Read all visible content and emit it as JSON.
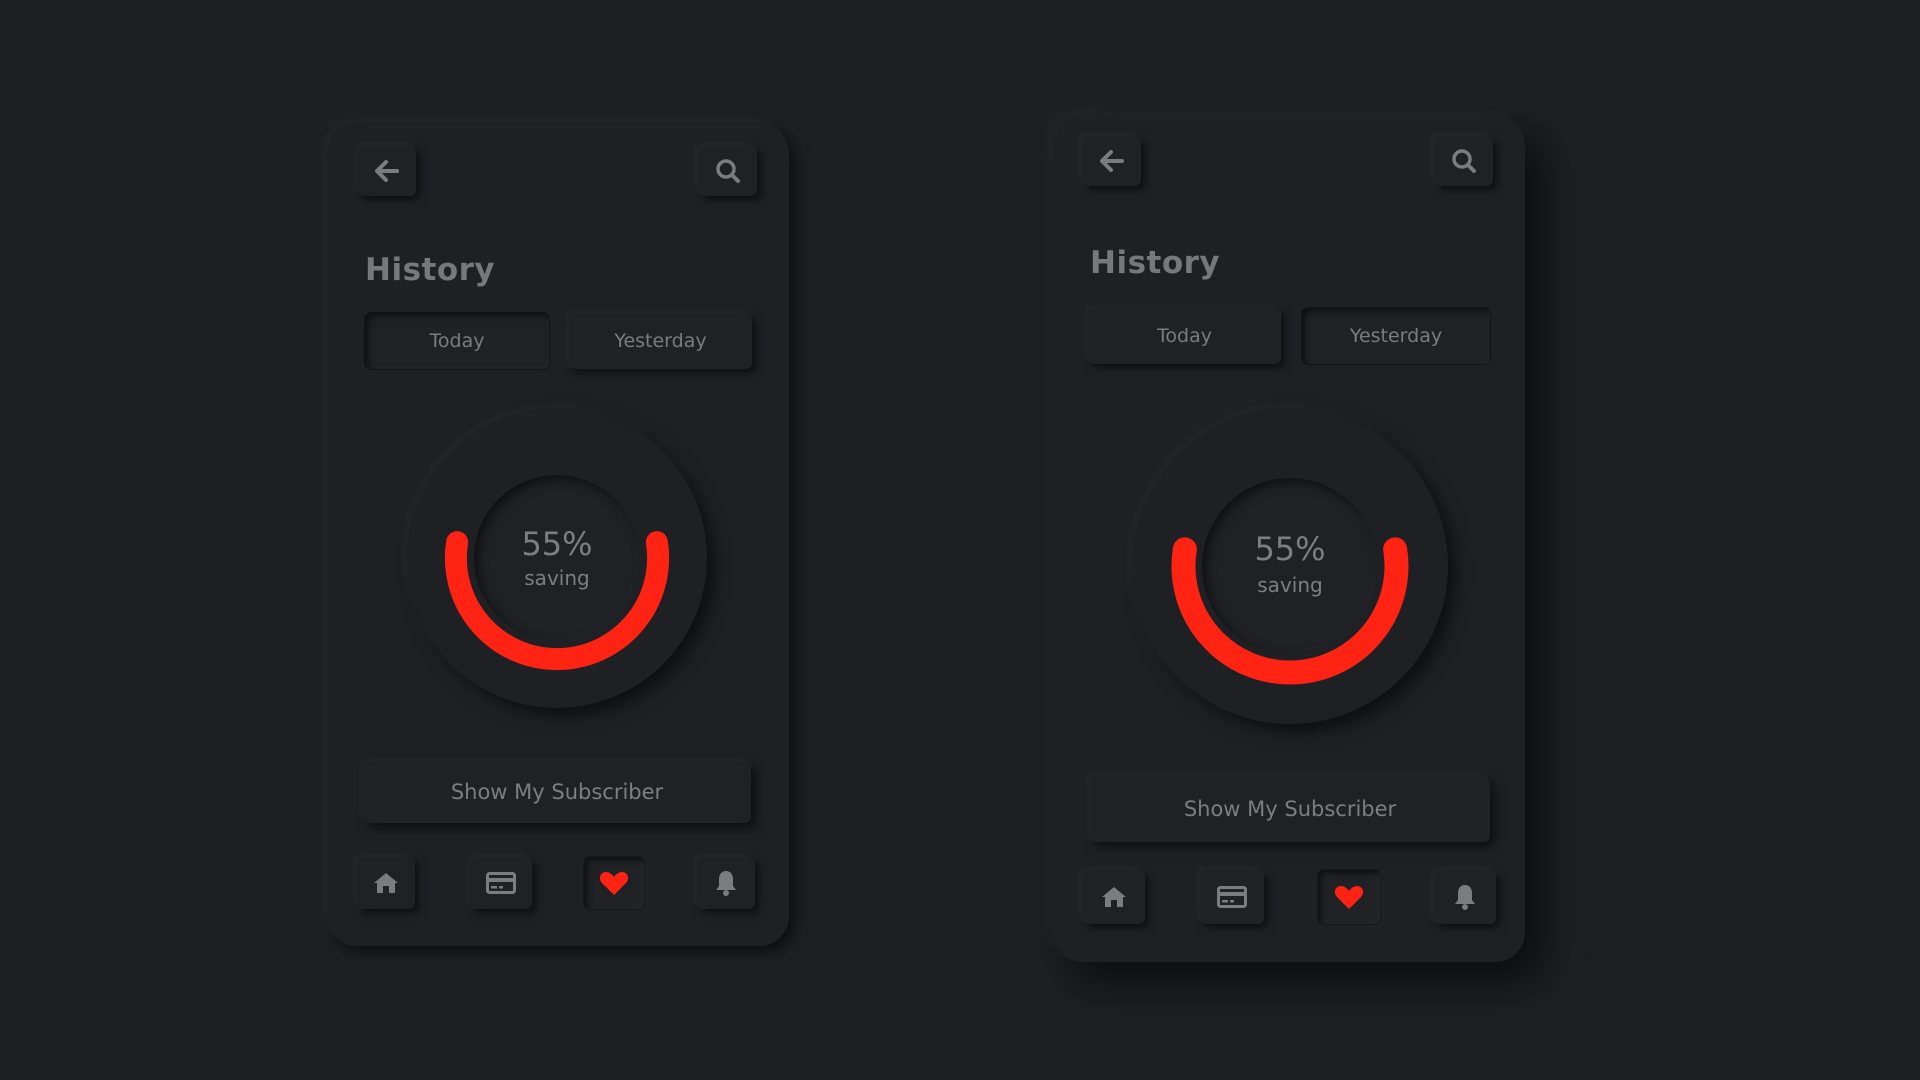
{
  "screens": [
    {
      "title": "History",
      "tabs": [
        {
          "label": "Today",
          "active": true
        },
        {
          "label": "Yesterday",
          "active": false
        }
      ],
      "gauge": {
        "value_text": "55%",
        "label": "saving",
        "progress": 0.55
      },
      "action_button": "Show My Subscriber",
      "nav": [
        "home-icon",
        "card-icon",
        "heart-icon",
        "bell-icon"
      ],
      "active_nav": "heart-icon"
    },
    {
      "title": "History",
      "tabs": [
        {
          "label": "Today",
          "active": false
        },
        {
          "label": "Yesterday",
          "active": true
        }
      ],
      "gauge": {
        "value_text": "55%",
        "label": "saving",
        "progress": 0.55
      },
      "action_button": "Show My Subscriber",
      "nav": [
        "home-icon",
        "card-icon",
        "heart-icon",
        "bell-icon"
      ],
      "active_nav": "heart-icon"
    }
  ],
  "colors": {
    "background": "#1d1f23",
    "accent": "#ff2314",
    "icon": "#7a7c80",
    "text": "#7a7c80"
  }
}
